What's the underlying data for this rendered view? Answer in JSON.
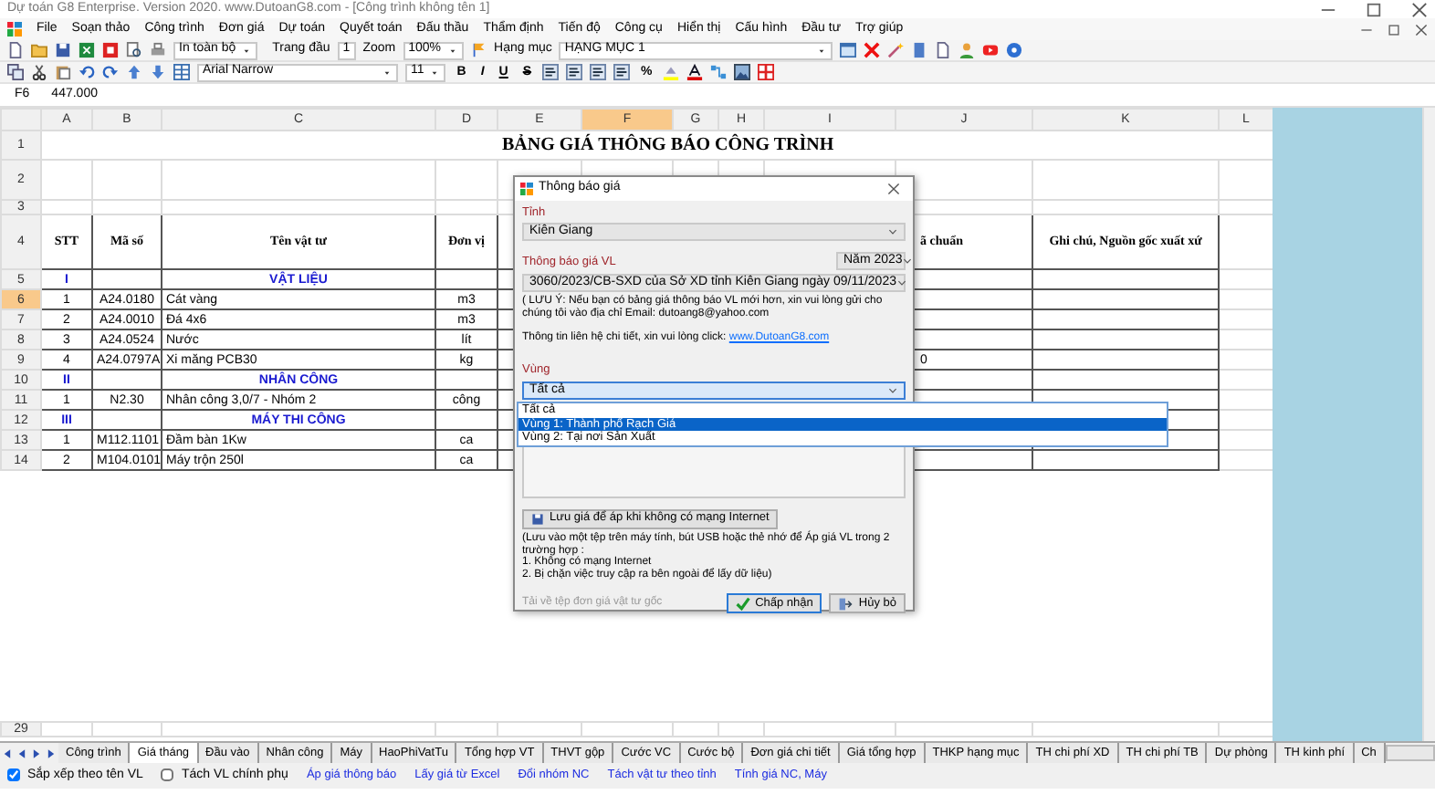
{
  "window": {
    "title": "Dự toán G8 Enterprise. Version 2020.   www.DutoanG8.com  - [Công trình không tên 1]"
  },
  "menu": [
    "File",
    "Soạn thảo",
    "Công trình",
    "Đơn giá",
    "Dự toán",
    "Quyết toán",
    "Đấu thầu",
    "Thẩm định",
    "Tiến độ",
    "Công cụ",
    "Hiển thị",
    "Cấu hình",
    "Đầu tư",
    "Trợ giúp"
  ],
  "toolbar": {
    "print_range": "In toàn bộ",
    "start_page_label": "Trang đầu",
    "start_page": "1",
    "zoom_label": "Zoom",
    "zoom": "100%",
    "category_label": "Hạng mục",
    "category": "HẠNG MỤC 1",
    "font": "Arial Narrow",
    "font_size": "11",
    "bold": "B",
    "italic": "I",
    "underline": "U",
    "strike": "S",
    "percent": "%"
  },
  "formula_bar": {
    "cell": "F6",
    "value": "447.000"
  },
  "sheet": {
    "columns": [
      {
        "label": "A",
        "selected": false
      },
      {
        "label": "B",
        "selected": false
      },
      {
        "label": "C",
        "selected": false
      },
      {
        "label": "D",
        "selected": false
      },
      {
        "label": "E",
        "selected": false
      },
      {
        "label": "F",
        "selected": true
      },
      {
        "label": "G",
        "selected": false
      },
      {
        "label": "H",
        "selected": false
      },
      {
        "label": "I",
        "selected": false
      },
      {
        "label": "J",
        "selected": false
      },
      {
        "label": "K",
        "selected": false
      },
      {
        "label": "L",
        "selected": false
      }
    ],
    "rows": [
      {
        "number": "1",
        "kind": "title",
        "text": "BẢNG GIÁ THÔNG BÁO CÔNG TRÌNH",
        "selected": false
      },
      {
        "number": "2",
        "kind": "blank",
        "selected": false
      },
      {
        "number": "3",
        "kind": "blank",
        "selected": false
      },
      {
        "number": "4",
        "kind": "header",
        "cells": [
          "STT",
          "Mã số",
          "Tên vật tư",
          "Đơn vị",
          "ã chuẩn",
          "Ghi chú, Nguồn gốc xuất xứ"
        ],
        "selected": false
      },
      {
        "number": "5",
        "kind": "section",
        "stt": "I",
        "name": "VẬT LIỆU",
        "selected": false
      },
      {
        "number": "6",
        "kind": "item",
        "stt": "1",
        "code": "A24.0180",
        "name": "Cát vàng",
        "unit": "m3",
        "selected": true
      },
      {
        "number": "7",
        "kind": "item",
        "stt": "2",
        "code": "A24.0010",
        "name": "Đá 4x6",
        "unit": "m3",
        "selected": false
      },
      {
        "number": "8",
        "kind": "item",
        "stt": "3",
        "code": "A24.0524",
        "name": "Nước",
        "unit": "lít",
        "selected": false
      },
      {
        "number": "9",
        "kind": "item",
        "stt": "4",
        "code": "A24.0797A",
        "name": "Xi măng PCB30",
        "unit": "kg",
        "col_j": "0",
        "selected": false
      },
      {
        "number": "10",
        "kind": "section",
        "stt": "II",
        "name": "NHÂN CÔNG",
        "selected": false
      },
      {
        "number": "11",
        "kind": "item",
        "stt": "1",
        "code": "N2.30",
        "name": "Nhân công 3,0/7 - Nhóm 2",
        "unit": "công",
        "selected": false
      },
      {
        "number": "12",
        "kind": "section",
        "stt": "III",
        "name": "MÁY THI CÔNG",
        "selected": false
      },
      {
        "number": "13",
        "kind": "item",
        "stt": "1",
        "code": "M112.1101",
        "name": "Đầm bàn 1Kw",
        "unit": "ca",
        "selected": false
      },
      {
        "number": "14",
        "kind": "item",
        "stt": "2",
        "code": "M104.0101",
        "name": "Máy trộn 250l",
        "unit": "ca",
        "selected": false
      },
      {
        "number": "29",
        "kind": "blank",
        "selected": false
      }
    ]
  },
  "sheet_tabs": [
    {
      "label": "Công trình",
      "selected": false
    },
    {
      "label": "Giá tháng",
      "selected": true
    },
    {
      "label": "Đầu vào",
      "selected": false
    },
    {
      "label": "Nhân công",
      "selected": false
    },
    {
      "label": "Máy",
      "selected": false
    },
    {
      "label": "HaoPhiVatTu",
      "selected": false
    },
    {
      "label": "Tổng hợp VT",
      "selected": false
    },
    {
      "label": "THVT gộp",
      "selected": false
    },
    {
      "label": "Cước VC",
      "selected": false
    },
    {
      "label": "Cước bộ",
      "selected": false
    },
    {
      "label": "Đơn giá chi tiết",
      "selected": false
    },
    {
      "label": "Giá tổng hợp",
      "selected": false
    },
    {
      "label": "THKP hạng mục",
      "selected": false
    },
    {
      "label": "TH chi phí XD",
      "selected": false
    },
    {
      "label": "TH chi phí TB",
      "selected": false
    },
    {
      "label": "Dự phòng",
      "selected": false
    },
    {
      "label": "TH kinh phí",
      "selected": false
    },
    {
      "label": "Ch",
      "selected": false
    }
  ],
  "options": [
    {
      "label": "Sắp xếp theo tên VL",
      "checked": true
    },
    {
      "label": "Tách VL chính phụ",
      "checked": false
    }
  ],
  "actions": [
    "Áp giá thông báo",
    "Lấy giá từ Excel",
    "Đổi nhóm NC",
    "Tách vật tư theo tỉnh",
    "Tính giá NC, Máy"
  ],
  "dialog": {
    "title": "Thông báo giá",
    "province_label": "Tỉnh",
    "province": "Kiên Giang",
    "notice_label": "Thông báo giá VL",
    "year": "Năm 2023",
    "notice": "3060/2023/CB-SXD của Sở XD tỉnh Kiên Giang ngày 09/11/2023",
    "note": "( LƯU Ý: Nếu bạn có bảng giá thông báo VL mới hơn, xin vui lòng gửi cho chúng tôi vào địa chỉ Email:  dutoang8@yahoo.com",
    "contact_text": "Thông tin liên hệ chi tiết, xin vui lòng click: ",
    "contact_link": "www.DutoanG8.com",
    "region_label": "Vùng",
    "region": "Tất cả",
    "region_options": [
      {
        "label": "Tất cả",
        "selected": false
      },
      {
        "label": "Vùng 1: Thành phố Rạch Giá",
        "selected": true
      },
      {
        "label": "Vùng 2: Tại nơi Sản Xuất",
        "selected": false
      }
    ],
    "save_button": "Lưu giá để áp khi không có mạng Internet",
    "save_note": [
      "(Lưu vào một tệp trên máy tính, bút USB hoặc thẻ nhớ để Áp giá VL trong 2 trường hợp :",
      "1. Không có mạng Internet",
      "2. Bị chặn việc truy cập ra bên ngoài để lấy dữ liệu)"
    ],
    "download_link": {
      "label": "Tải về tệp đơn giá vật tư gốc",
      "disabled": true
    },
    "ok": "Chấp nhận",
    "cancel": "Hủy bỏ"
  }
}
